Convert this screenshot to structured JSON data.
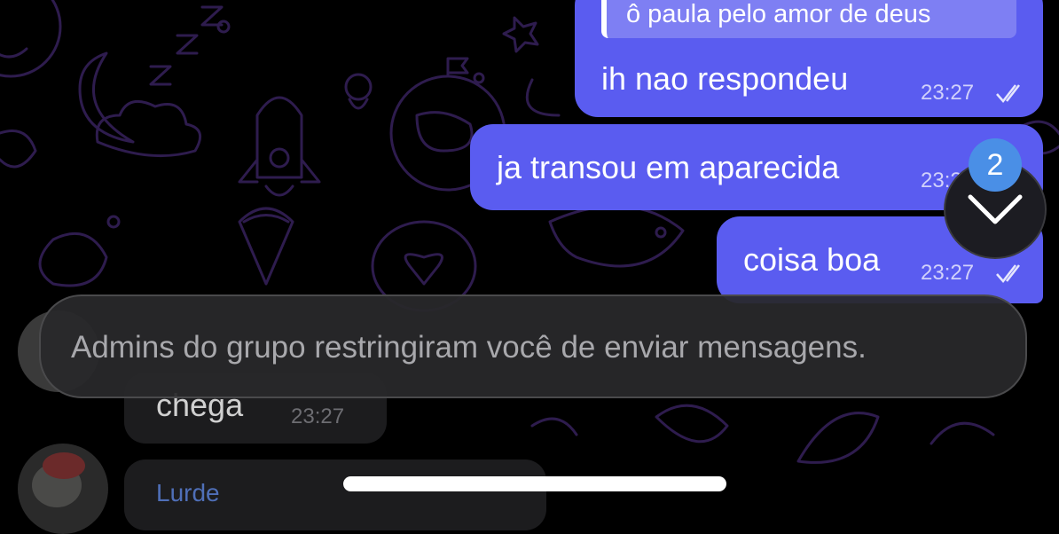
{
  "messages_out": [
    {
      "reply_quote": "ô paula pelo amor de deus",
      "text": "ih nao respondeu",
      "time": "23:27",
      "status": "read"
    },
    {
      "text": "ja transou em aparecida",
      "time": "23:27",
      "status": "read"
    },
    {
      "text": "coisa boa",
      "time": "23:27",
      "status": "read"
    }
  ],
  "messages_in": [
    {
      "text": "chega",
      "time": "23:27"
    },
    {
      "sender": "Lurde"
    }
  ],
  "restriction_banner": {
    "text": "Admins do grupo restringiram você de enviar mensagens."
  },
  "scroll_down": {
    "unread_count": "2",
    "icon": "chevron-down-icon"
  },
  "colors": {
    "outgoing_bubble": "#5a5cf0",
    "incoming_bubble": "#1c1c1e",
    "badge": "#4a8fe6",
    "doodle": "#2e1c4e"
  }
}
